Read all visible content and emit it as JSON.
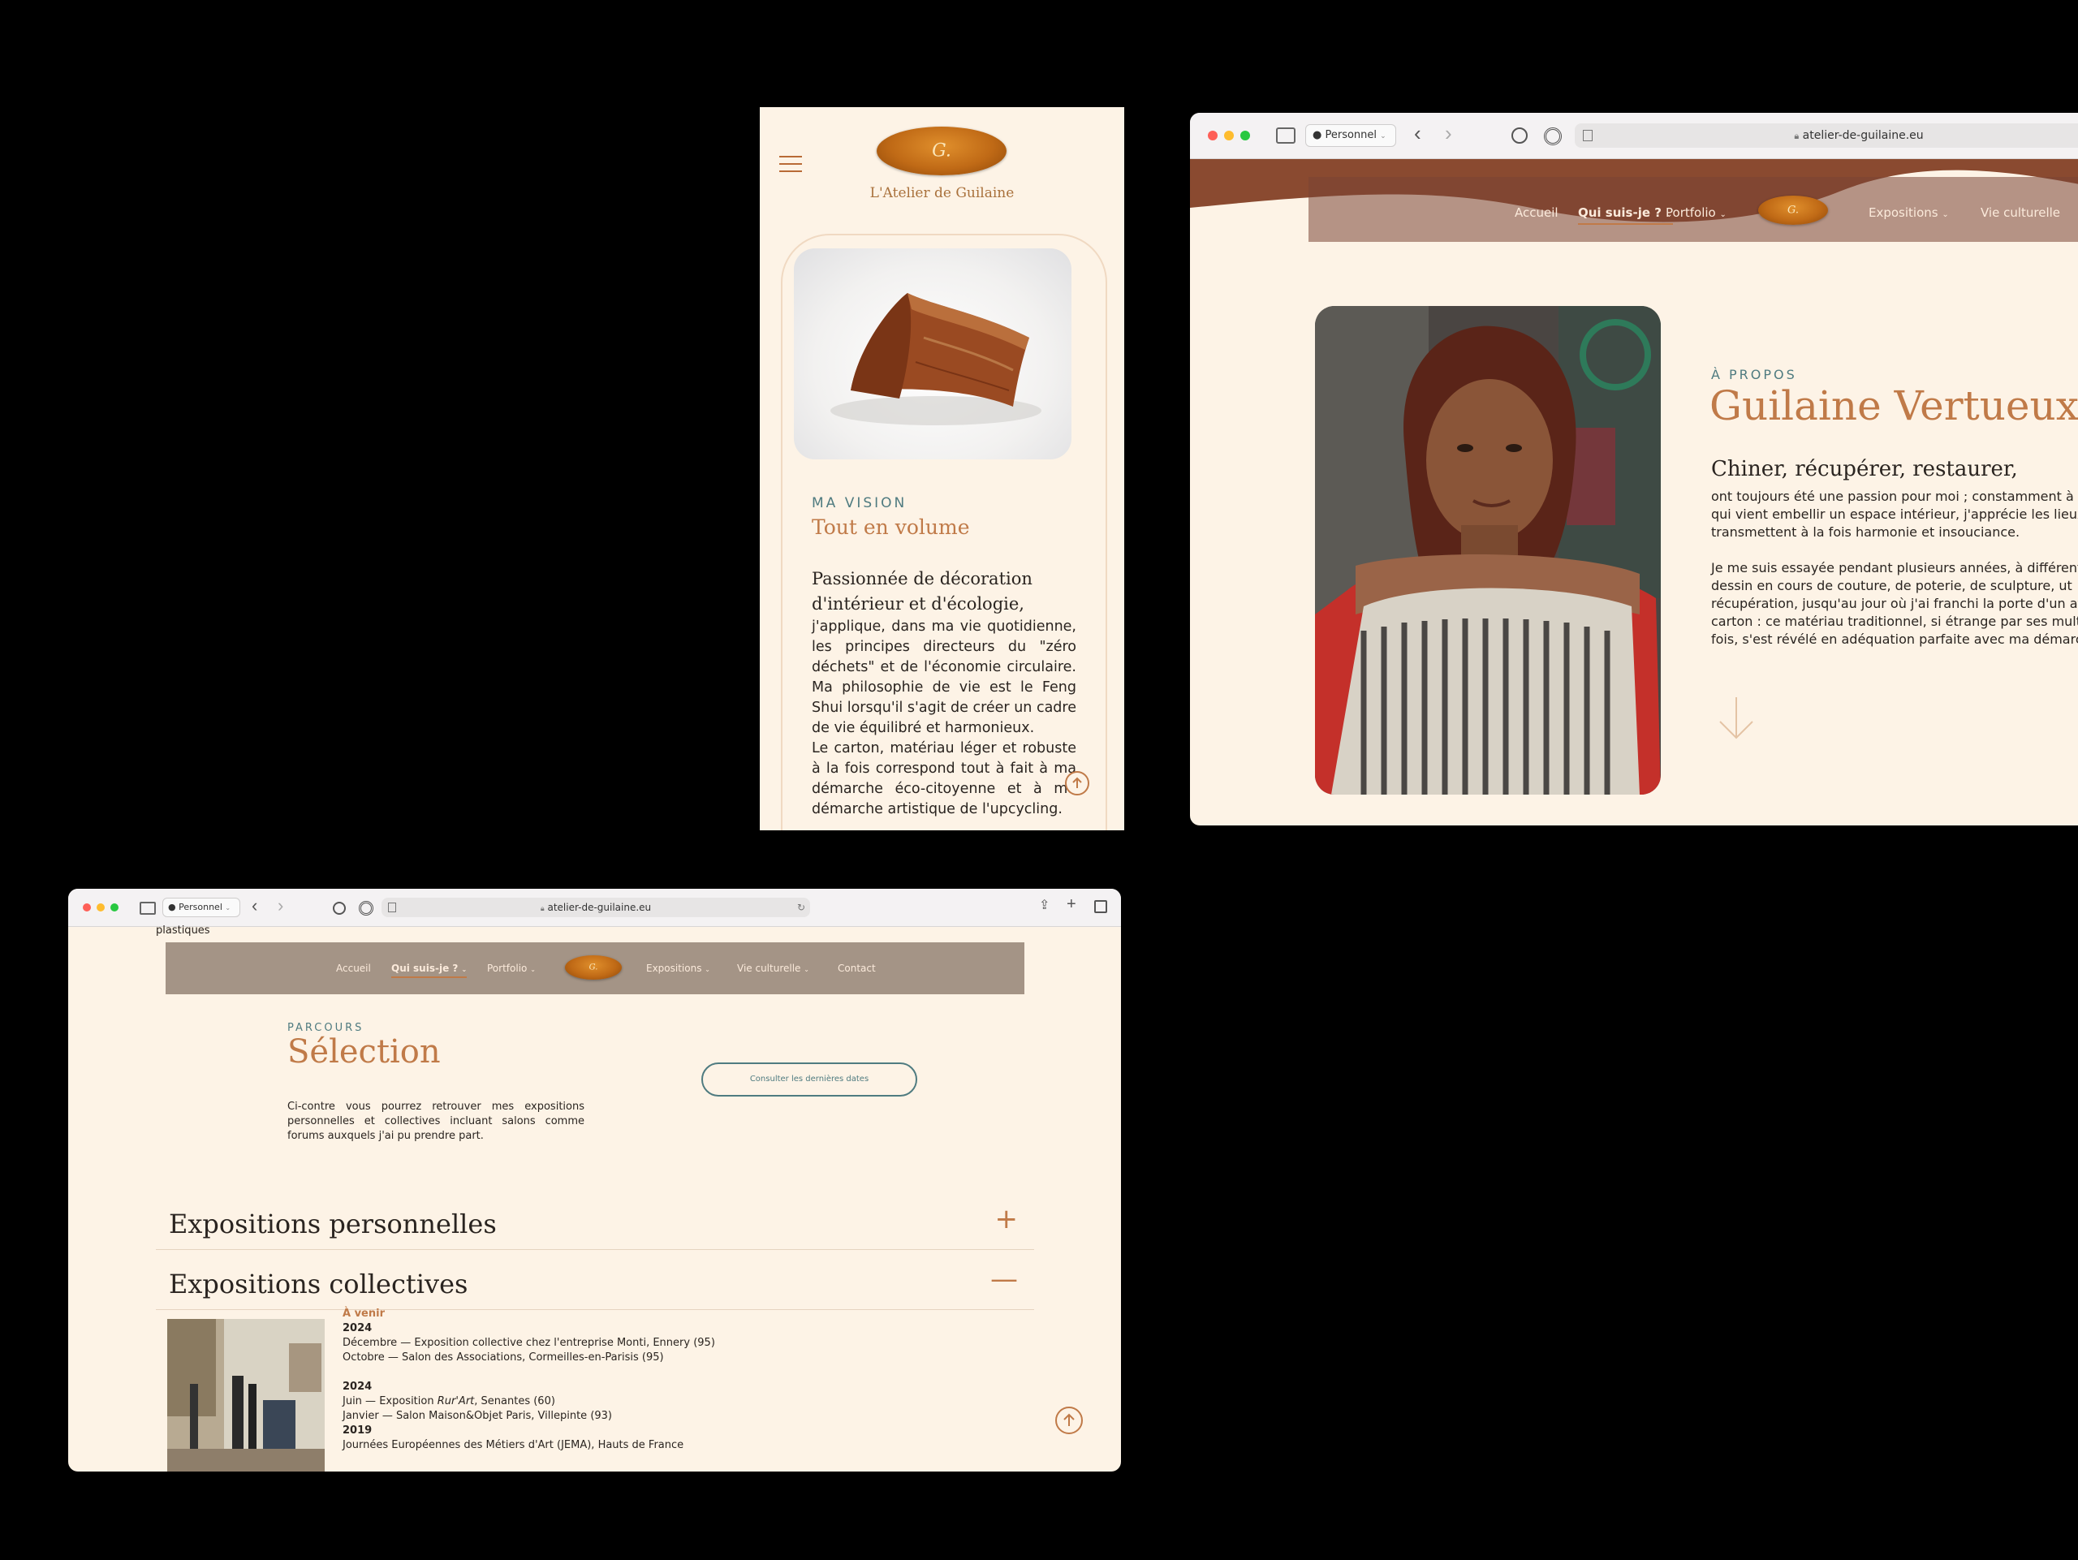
{
  "mobile": {
    "brand": "L'Atelier de Guilaine",
    "kicker": "MA VISION",
    "title": "Tout en volume",
    "lead": "Passionnée de décoration d'intérieur et d'écologie,",
    "body_1": "j'applique, dans ma vie quotidienne, les principes directeurs du \"zéro déchets\" et de l'économie circulaire. Ma philosophie de vie est le Feng Shui lorsqu'il s'agit de créer un cadre de vie équilibré et harmonieux.",
    "body_2": "Le carton, matériau léger et robuste à la fois correspond tout à fait à ma démarche éco-citoyenne et à ma démarche artistique de l'upcycling."
  },
  "browser_about": {
    "profile": "Personnel",
    "url": "atelier-de-guilaine.eu",
    "nav": [
      "Accueil",
      "Qui suis-je ?",
      "Portfolio",
      "Expositions",
      "Vie culturelle"
    ],
    "kicker": "À PROPOS",
    "title": "Guilaine Vertueux",
    "lead": "Chiner, récupérer, restaurer,",
    "p1_lines": [
      "ont toujours été une passion pour moi ; constamment à la rec",
      "qui vient embellir un espace intérieur, j'apprécie les lieux a",
      "transmettent à la fois harmonie et insouciance."
    ],
    "p2_lines": [
      "Je me suis essayée pendant plusieurs années, à différentes p",
      "dessin en cours de couture, de poterie, de sculpture, ut",
      "récupération, jusqu'au jour où j'ai franchi la porte d'un atelie",
      "carton : ce matériau traditionnel, si étrange par ses multiples",
      "fois, s'est révélé en adéquation parfaite avec ma démarche cr"
    ]
  },
  "browser_expo": {
    "profile": "Personnel",
    "url": "atelier-de-guilaine.eu",
    "top_text": "plastiques",
    "nav": [
      "Accueil",
      "Qui suis-je ?",
      "Portfolio",
      "Expositions",
      "Vie culturelle",
      "Contact"
    ],
    "kicker": "PARCOURS",
    "title": "Sélection",
    "desc": "Ci-contre vous pourrez retrouver mes expositions personnelles et collectives incluant salons comme forums auxquels j'ai pu prendre part.",
    "button": "Consulter les dernières dates",
    "accordion_1": "Expositions personnelles",
    "accordion_1_toggle": "+",
    "accordion_2": "Expositions collectives",
    "accordion_2_toggle": "—",
    "upcoming": "À venir",
    "year_a": "2024",
    "ev_1": "Décembre — Exposition collective chez l'entreprise Monti, Ennery (95)",
    "ev_2": "Octobre — Salon des Associations, Cormeilles-en-Parisis (95)",
    "year_b": "2024",
    "ev_3_pre": "Juin — Exposition ",
    "ev_3_em": "Rur'Art",
    "ev_3_post": ", Senantes (60)",
    "ev_4": "Janvier — Salon Maison&Objet Paris, Villepinte (93)",
    "year_c": "2019",
    "ev_5": "Journées Européennes des Métiers d'Art (JEMA), Hauts de France"
  },
  "colors": {
    "accent": "#c07a48",
    "teal": "#4f7b80",
    "cream": "#fdf3e6",
    "brown_band": "#8a4a30",
    "nav_taupe": "#a49486"
  },
  "icons": [
    "hamburger-icon",
    "scroll-top-icon",
    "sidebar-icon",
    "user-icon",
    "back-icon",
    "forward-icon",
    "shield-icon",
    "privacy-icon",
    "reader-icon",
    "lock-icon",
    "reload-icon",
    "share-icon",
    "plus-icon",
    "tabs-icon",
    "chevron-down-icon",
    "arrow-down-icon"
  ]
}
